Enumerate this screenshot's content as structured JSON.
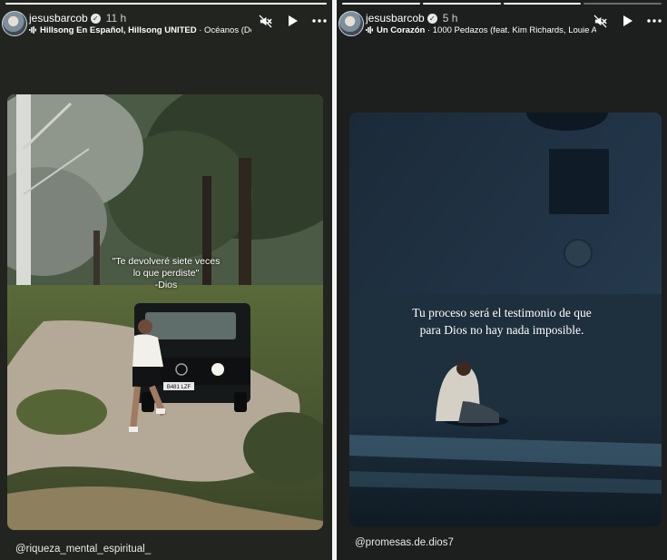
{
  "stories": [
    {
      "username": "jesusbarcob",
      "time": "11 h",
      "music_artist": "Hillsong En Español, Hillsong UNITED",
      "music_separator": " · ",
      "music_title": "Océanos (Donc",
      "caption_line1": "\"Te devolveré siete veces",
      "caption_line2": "lo que perdiste\"",
      "caption_line3": "-Dios",
      "mention": "@riqueza_mental_espiritual_",
      "progress": [
        1.0
      ]
    },
    {
      "username": "jesusbarcob",
      "time": "5 h",
      "music_artist": "Un Corazón",
      "music_separator": " · ",
      "music_title": "1000 Pedazos (feat. Kim Richards, Louie A",
      "caption_line1": "Tu proceso será el testimonio de que",
      "caption_line2": "para Dios no hay nada imposible.",
      "mention": "@promesas.de.dios7",
      "progress": [
        1.0,
        1.0,
        1.0,
        0.0
      ]
    }
  ],
  "icons": {
    "mute": "mute-icon",
    "play": "play-icon",
    "more": "more-options-icon",
    "verified": "verified-badge-icon",
    "music": "music-icon"
  },
  "verified_glyph": "✓",
  "license_plate": "B481 LZF"
}
